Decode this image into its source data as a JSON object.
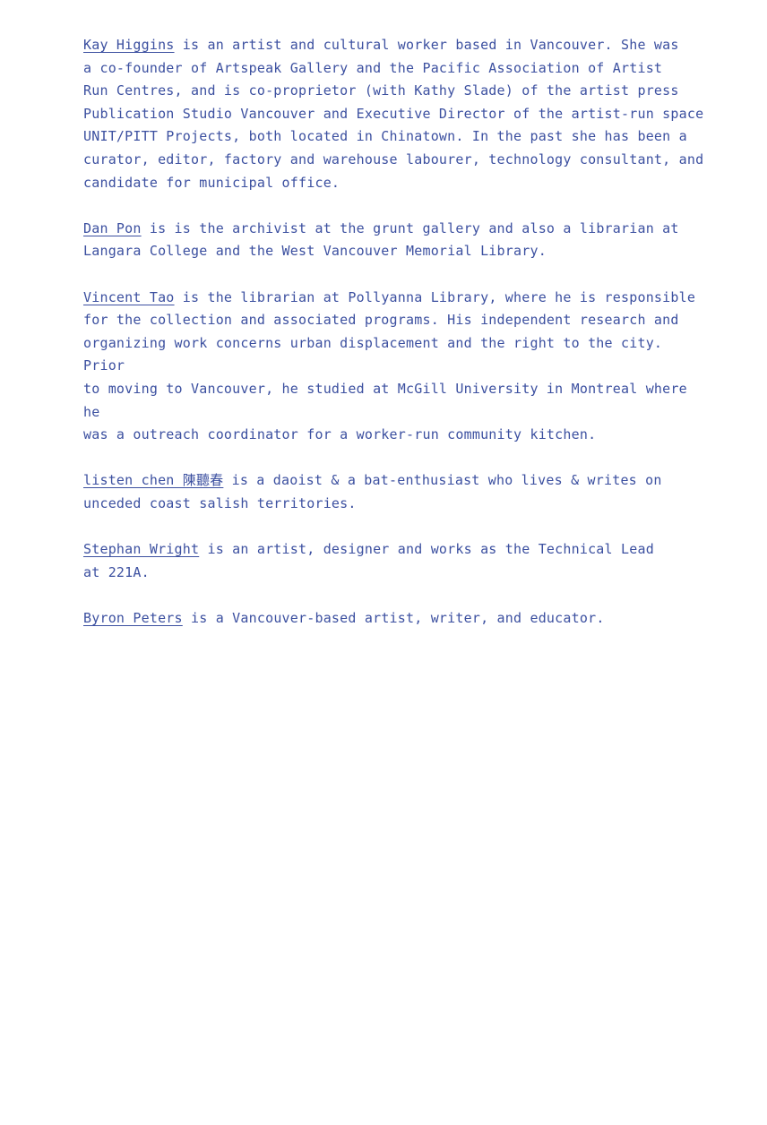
{
  "bios": [
    {
      "name": "Kay Higgins",
      "text": " is an artist and cultural worker based in Vancouver. She was\na co-founder of Artspeak Gallery and the Pacific Association of Artist\nRun Centres, and is co-proprietor (with Kathy Slade) of the artist press\nPublication Studio Vancouver and Executive Director of the artist-run space\nUNIT/PITT Projects, both located in Chinatown. In the past she has been a\ncurator, editor, factory and warehouse labourer, technology  consultant, and\ncandidate for municipal office."
    },
    {
      "name": "Dan Pon",
      "text": " is is the archivist at the grunt gallery and also a librarian at\nLangara College and the West Vancouver Memorial Library."
    },
    {
      "name": "Vincent Tao",
      "text": " is the librarian at Pollyanna Library, where he is responsible\nfor the collection and associated programs. His independent research and\norganizing work concerns urban displacement and the right to the city. Prior\nto moving to Vancouver, he studied at McGill University in Montreal where he\nwas a outreach coordinator for a worker-run community kitchen."
    },
    {
      "name": "listen chen 陳聽春",
      "text": " is a daoist & a bat-enthusiast who lives & writes on\nunceded coast salish territories."
    },
    {
      "name": "Stephan Wright",
      "text": " is an artist, designer and works as the Technical Lead\nat 221A."
    },
    {
      "name": "Byron Peters",
      "text": " is a Vancouver-based artist, writer, and educator."
    }
  ]
}
